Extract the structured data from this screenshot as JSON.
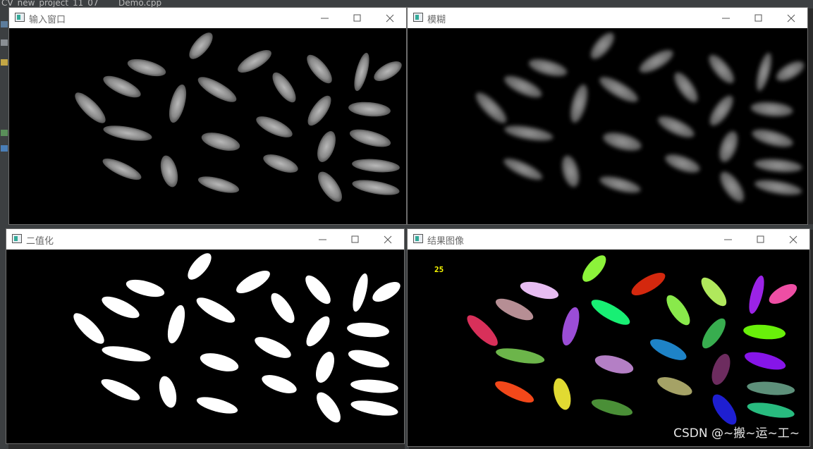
{
  "ide": {
    "project_tab": "CV_new_project_11_07",
    "file_tab": "Demo.cpp"
  },
  "windows": {
    "input": {
      "title": "输入窗口"
    },
    "blur": {
      "title": "模糊"
    },
    "binary": {
      "title": "二值化"
    },
    "result": {
      "title": "结果图像",
      "count_label": "25"
    }
  },
  "controls": {
    "minimize": "minimize-icon",
    "maximize": "maximize-icon",
    "close": "close-icon"
  },
  "colors": {
    "label_text": "#ffff00",
    "titlebar": "#ffffff",
    "image_bg": "#000000"
  },
  "watermark": "CSDN @~搬~运~工~"
}
